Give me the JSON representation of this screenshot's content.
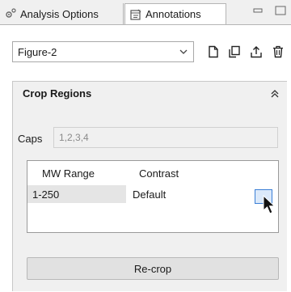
{
  "tabs": [
    {
      "label": "Analysis Options",
      "icon": "gear-molecule-icon",
      "active": false
    },
    {
      "label": "Annotations",
      "icon": "annotation-table-icon",
      "active": true
    }
  ],
  "window_controls": {
    "minimize_icon": "minimize-icon",
    "restore_icon": "restore-icon"
  },
  "figure_select": {
    "value": "Figure-2"
  },
  "toolbar_icons": [
    "new-document-icon",
    "copy-icon",
    "export-icon",
    "delete-icon"
  ],
  "crop_regions": {
    "title": "Crop Regions",
    "collapse_icon": "double-chevron-up-icon",
    "caps_label": "Caps",
    "caps_value": "1,2,3,4",
    "table": {
      "headers": [
        "MW Range",
        "Contrast"
      ],
      "rows": [
        {
          "mw_range": "1-250",
          "contrast": "Default"
        }
      ]
    },
    "recrop_label": "Re-crop"
  },
  "colors": {
    "accent": "#3c7fd6",
    "background": "#f0f0f0",
    "panel": "#ffffff"
  }
}
